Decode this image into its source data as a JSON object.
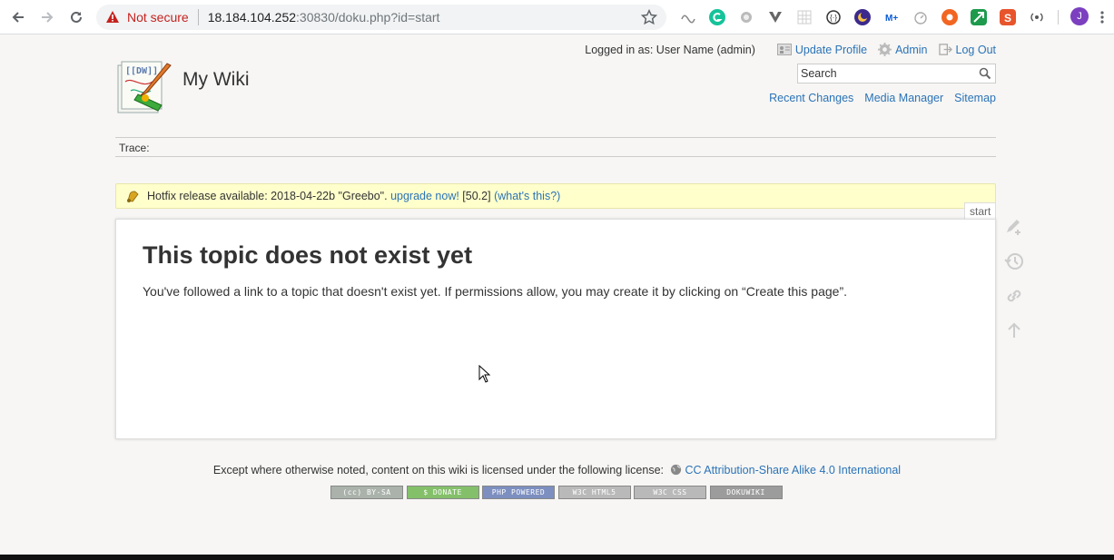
{
  "browser": {
    "security_label": "Not secure",
    "url_host": "18.184.104.252",
    "url_rest": ":30830/doku.php?id=start",
    "profile_initial": "J"
  },
  "wiki": {
    "title": "My Wiki",
    "logged_in": "Logged in as: User Name (admin)",
    "user_links": [
      "Update Profile",
      "Admin",
      "Log Out"
    ],
    "search_placeholder": "Search",
    "site_links": [
      "Recent Changes",
      "Media Manager",
      "Sitemap"
    ],
    "trace_label": "Trace:"
  },
  "notice": {
    "text_before": "Hotfix release available: 2018-04-22b \"Greebo\". ",
    "upgrade_link": "upgrade now!",
    "text_mid": " [50.2] ",
    "whats_this": "(what's this?)"
  },
  "page": {
    "id": "start",
    "heading": "This topic does not exist yet",
    "body": "You've followed a link to a topic that doesn't exist yet. If permissions allow, you may create it by clicking on “Create this page”."
  },
  "footer": {
    "license_text": "Except where otherwise noted, content on this wiki is licensed under the following license: ",
    "license_link": "CC Attribution-Share Alike 4.0 International",
    "badges": [
      {
        "label": "(cc) BY-SA",
        "color": "#aab2ab"
      },
      {
        "label": "$ DONATE",
        "color": "#84c06a"
      },
      {
        "label": "PHP POWERED",
        "color": "#7d8fc0"
      },
      {
        "label": "W3C HTML5",
        "color": "#b9b9b9"
      },
      {
        "label": "W3C CSS",
        "color": "#b9b9b9"
      },
      {
        "label": "DOKUWIKI",
        "color": "#9c9c9c"
      }
    ]
  },
  "colors": {
    "link": "#2b73b7",
    "notice_bg": "#ffffcc",
    "page_bg": "#f7f6f4"
  }
}
